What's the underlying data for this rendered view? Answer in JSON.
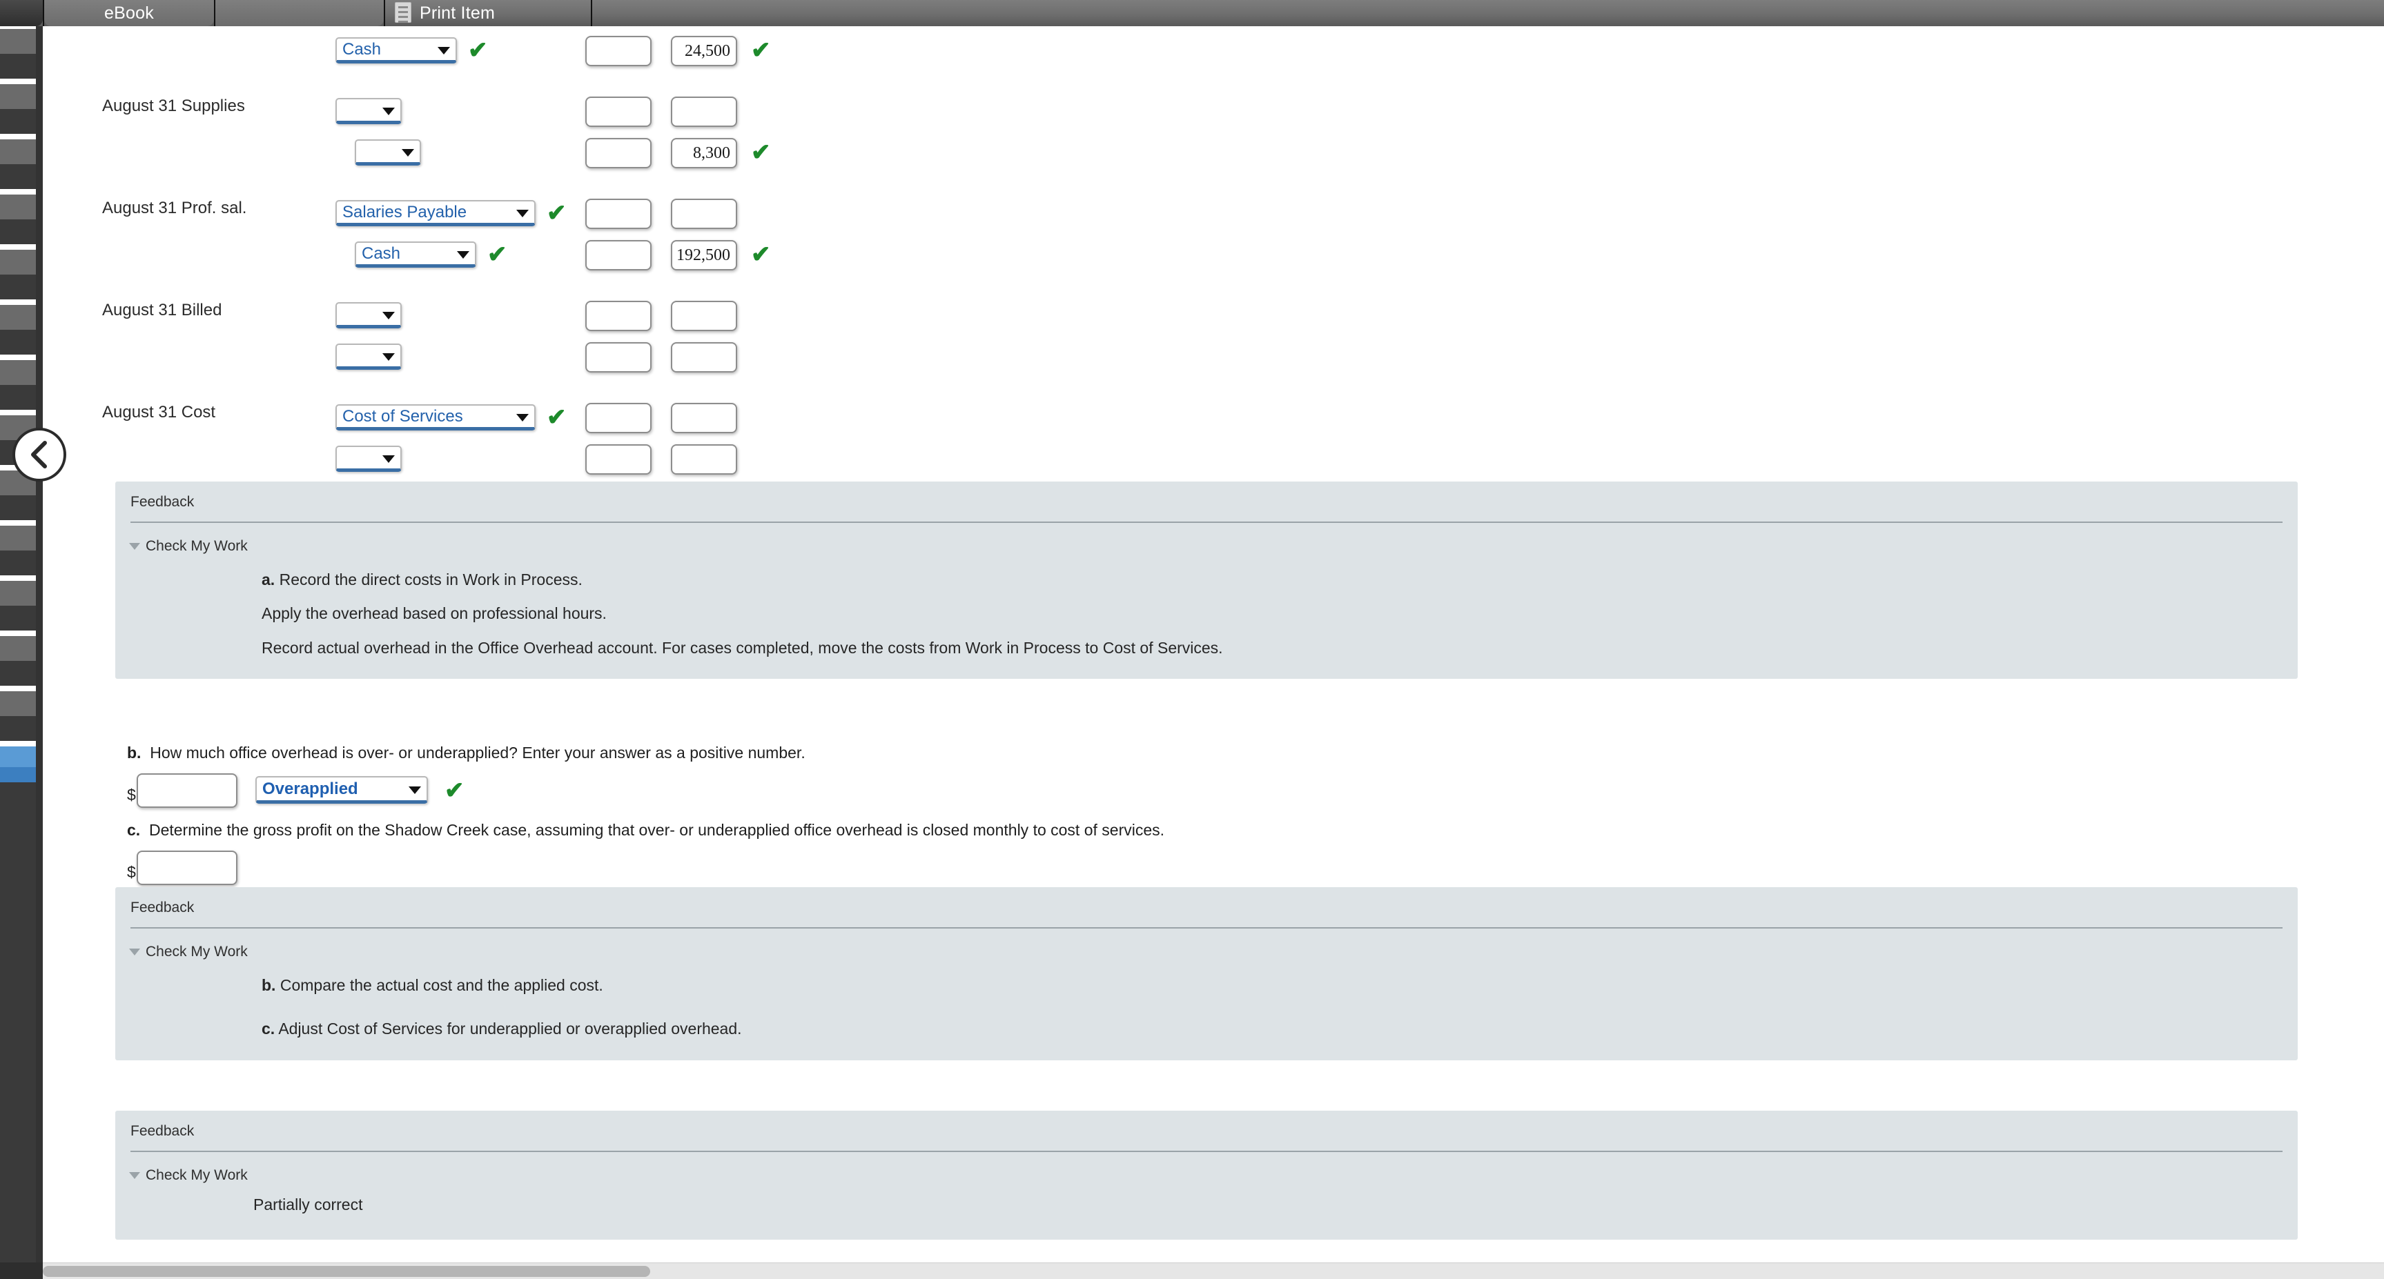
{
  "toolbar": {
    "ebook_label": "eBook",
    "blank_label": "",
    "print_label": "Print Item",
    "print_icon": "document-icon"
  },
  "sidebar": {
    "collapse_icon": "chevron-left-icon",
    "collapse_label": "<"
  },
  "journal": {
    "rows": [
      {
        "date": "",
        "lines": [
          {
            "indent": 0,
            "account": "Cash",
            "width": "w-wide",
            "checked": true,
            "debit": "",
            "credit": "24,500",
            "amount_checked": true
          }
        ]
      },
      {
        "date": "August 31 Supplies",
        "lines": [
          {
            "indent": 0,
            "account": "",
            "width": "w-narrow",
            "checked": false,
            "debit": "",
            "credit": "",
            "amount_checked": false
          },
          {
            "indent": 1,
            "account": "",
            "width": "w-narrow",
            "checked": false,
            "debit": "",
            "credit": "8,300",
            "amount_checked": true
          }
        ]
      },
      {
        "date": "August 31 Prof. sal.",
        "lines": [
          {
            "indent": 0,
            "account": "Salaries Payable",
            "width": "w-widest",
            "checked": true,
            "debit": "",
            "credit": "",
            "amount_checked": false
          },
          {
            "indent": 1,
            "account": "Cash",
            "width": "w-wide",
            "checked": true,
            "debit": "",
            "credit": "192,500",
            "amount_checked": true
          }
        ]
      },
      {
        "date": "August 31 Billed",
        "lines": [
          {
            "indent": 0,
            "account": "",
            "width": "w-narrow",
            "checked": false,
            "debit": "",
            "credit": "",
            "amount_checked": false
          },
          {
            "indent": 0,
            "account": "",
            "width": "w-narrow",
            "checked": false,
            "debit": "",
            "credit": "",
            "amount_checked": false
          }
        ]
      },
      {
        "date": "August 31 Cost",
        "lines": [
          {
            "indent": 0,
            "account": "Cost of Services",
            "width": "w-widest",
            "checked": true,
            "debit": "",
            "credit": "",
            "amount_checked": false
          },
          {
            "indent": 0,
            "account": "",
            "width": "w-narrow",
            "checked": false,
            "debit": "",
            "credit": "",
            "amount_checked": false
          }
        ]
      }
    ]
  },
  "feedback_a": {
    "title": "Feedback",
    "check_my_work": "Check My Work",
    "line1_marker": "a.",
    "line1": "Record the direct costs in Work in Process.",
    "line2": "Apply the overhead based on professional hours.",
    "line3": "Record actual overhead in the Office Overhead account. For cases completed, move the costs from Work in Process to Cost of Services."
  },
  "question_b": {
    "marker": "b.",
    "text": "How much office overhead is over- or underapplied? Enter your answer as a positive number.",
    "dollar": "$",
    "input_value": "",
    "select_value": "Overapplied",
    "checked": true
  },
  "question_c": {
    "marker": "c.",
    "text": "Determine the gross profit on the Shadow Creek case, assuming that over- or underapplied office overhead is closed monthly to cost of services.",
    "dollar": "$",
    "input_value": ""
  },
  "feedback_bc": {
    "title": "Feedback",
    "check_my_work": "Check My Work",
    "line1_marker": "b.",
    "line1": "Compare the actual cost and the applied cost.",
    "line2_marker": "c.",
    "line2": "Adjust Cost of Services for underapplied or overapplied overhead."
  },
  "feedback_overall": {
    "title": "Feedback",
    "check_my_work": "Check My Work",
    "status": "Partially correct"
  },
  "colors": {
    "toolbar_gray": "#6e6e6e",
    "sidebar_dark": "#3a3a3a",
    "sidebar_active": "#5a9bd5",
    "feedback_bg": "#dde3e6",
    "select_text": "#2361ab",
    "check_green": "#1d8a2b",
    "select_underline": "#3a6ea5"
  }
}
